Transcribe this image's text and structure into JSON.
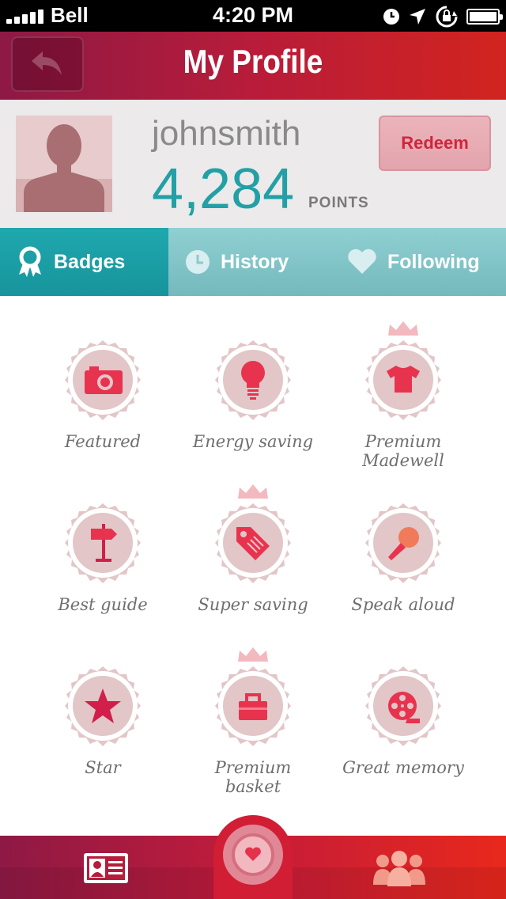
{
  "status_bar": {
    "carrier": "Bell",
    "time": "4:20 PM",
    "icons": [
      "signal-icon",
      "clock-icon",
      "location-arrow-icon",
      "rotation-lock-icon",
      "battery-icon"
    ]
  },
  "navbar": {
    "title": "My Profile",
    "back_icon": "back-arrow-icon"
  },
  "profile": {
    "username": "johnsmith",
    "points": "4,284",
    "points_label": "POINTS",
    "redeem_label": "Redeem"
  },
  "tabs": [
    {
      "label": "Badges",
      "icon": "ribbon-icon",
      "active": true
    },
    {
      "label": "History",
      "icon": "clock-icon",
      "active": false
    },
    {
      "label": "Following",
      "icon": "heart-icon",
      "active": false
    }
  ],
  "badges": [
    {
      "label": "Featured",
      "icon": "camera-icon",
      "premium": false
    },
    {
      "label": "Energy saving",
      "icon": "lightbulb-icon",
      "premium": false
    },
    {
      "label": "Premium\nMadewell",
      "label_l1": "Premium",
      "label_l2": "Madewell",
      "icon": "tshirt-icon",
      "premium": true
    },
    {
      "label": "Best guide",
      "icon": "signpost-icon",
      "premium": false
    },
    {
      "label": "Super saving",
      "icon": "price-tag-icon",
      "premium": true
    },
    {
      "label": "Speak aloud",
      "icon": "microphone-icon",
      "premium": false
    },
    {
      "label": "Star",
      "icon": "star-icon",
      "premium": false
    },
    {
      "label": "Premium\nbasket",
      "label_l1": "Premium",
      "label_l2": "basket",
      "icon": "basket-icon",
      "premium": true
    },
    {
      "label": "Great memory",
      "icon": "film-reel-icon",
      "premium": false
    }
  ],
  "colors": {
    "nav_gradient_start": "#8e1945",
    "nav_gradient_end": "#d2241f",
    "accent_teal": "#22a0a6",
    "badge_bg": "#e2c6c8",
    "badge_icon": "#e8334f"
  },
  "bottom_bar": {
    "items": [
      "profile-card-icon",
      "target-heart-icon",
      "people-icon"
    ]
  }
}
